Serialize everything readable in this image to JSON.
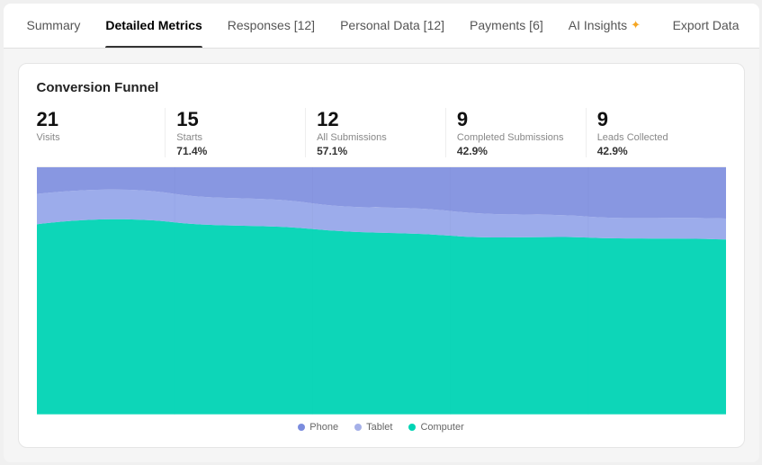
{
  "tabs": [
    {
      "id": "summary",
      "label": "Summary",
      "active": false
    },
    {
      "id": "detailed-metrics",
      "label": "Detailed Metrics",
      "active": true
    },
    {
      "id": "responses",
      "label": "Responses [12]",
      "active": false
    },
    {
      "id": "personal-data",
      "label": "Personal Data [12]",
      "active": false
    },
    {
      "id": "payments",
      "label": "Payments [6]",
      "active": false
    },
    {
      "id": "ai-insights",
      "label": "AI Insights",
      "active": false
    }
  ],
  "export_label": "Export Data",
  "card_title": "Conversion Funnel",
  "metrics": [
    {
      "id": "visits",
      "number": "21",
      "label": "Visits",
      "pct": ""
    },
    {
      "id": "starts",
      "number": "15",
      "label": "Starts",
      "pct": "71.4%"
    },
    {
      "id": "all-submissions",
      "number": "12",
      "label": "All Submissions",
      "pct": "57.1%"
    },
    {
      "id": "completed-submissions",
      "number": "9",
      "label": "Completed Submissions",
      "pct": "42.9%"
    },
    {
      "id": "leads-collected",
      "number": "9",
      "label": "Leads Collected",
      "pct": "42.9%"
    }
  ],
  "legend": [
    {
      "id": "phone",
      "label": "Phone",
      "color": "#7b8cde"
    },
    {
      "id": "tablet",
      "label": "Tablet",
      "color": "#a5b0e8"
    },
    {
      "id": "computer",
      "label": "Computer",
      "color": "#00d4b4"
    }
  ],
  "colors": {
    "phone": "#7b8cde",
    "tablet": "#a5b0e8",
    "computer": "#00d4b4",
    "phone_dark": "#6676cc"
  }
}
